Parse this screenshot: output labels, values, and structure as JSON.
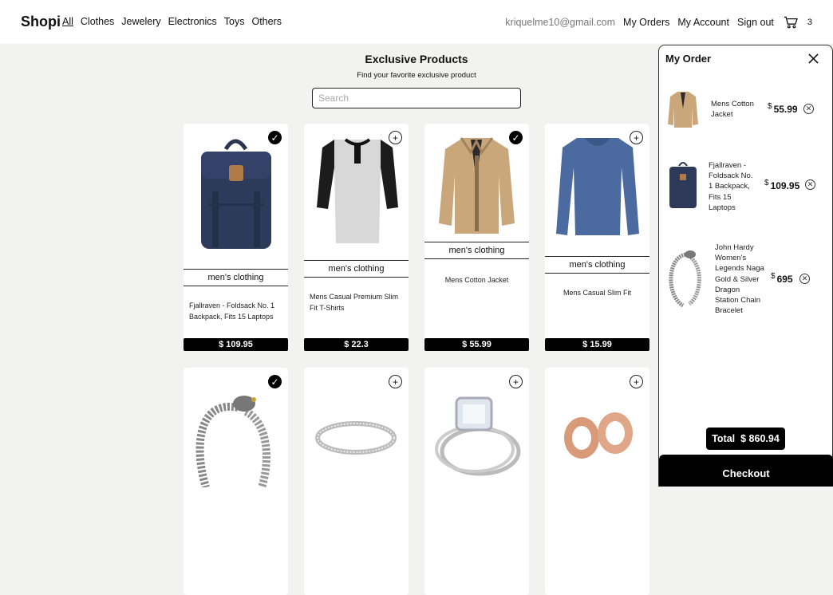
{
  "nav": {
    "brand": "Shopi",
    "links": [
      "All",
      "Clothes",
      "Jewelery",
      "Electronics",
      "Toys",
      "Others"
    ],
    "email": "kriquelme10@gmail.com",
    "my_orders": "My Orders",
    "my_account": "My Account",
    "sign_out": "Sign out",
    "cart_count": "3"
  },
  "header": {
    "title": "Exclusive Products",
    "subtitle": "Find your favorite exclusive product",
    "search_placeholder": "Search"
  },
  "products": [
    {
      "category": "men's clothing",
      "title": "Fjallraven - Foldsack No. 1 Backpack, Fits 15 Laptops",
      "price": "$ 109.95",
      "added": true
    },
    {
      "category": "men's clothing",
      "title": "Mens Casual Premium Slim Fit T-Shirts",
      "price": "$ 22.3",
      "added": false
    },
    {
      "category": "men's clothing",
      "title": "Mens Cotton Jacket",
      "price": "$ 55.99",
      "added": true
    },
    {
      "category": "men's clothing",
      "title": "Mens Casual Slim Fit",
      "price": "$ 15.99",
      "added": false
    },
    {
      "added": true
    },
    {
      "added": false
    },
    {
      "added": false
    },
    {
      "added": false
    }
  ],
  "order": {
    "title": "My Order",
    "items": [
      {
        "name": "Mens Cotton Jacket",
        "currency": "$",
        "price": "55.99"
      },
      {
        "name": "Fjallraven - Foldsack No. 1 Backpack, Fits 15 Laptops",
        "currency": "$",
        "price": "109.95"
      },
      {
        "name": "John Hardy Women's Legends Naga Gold & Silver Dragon Station Chain Bracelet",
        "currency": "$",
        "price": "695"
      }
    ],
    "total_label": "Total",
    "total_value": "$ 860.94",
    "checkout": "Checkout"
  },
  "colors": {
    "accent": "#000000",
    "page_bg": "#f2f2f1",
    "card_bg": "#ffffff"
  }
}
